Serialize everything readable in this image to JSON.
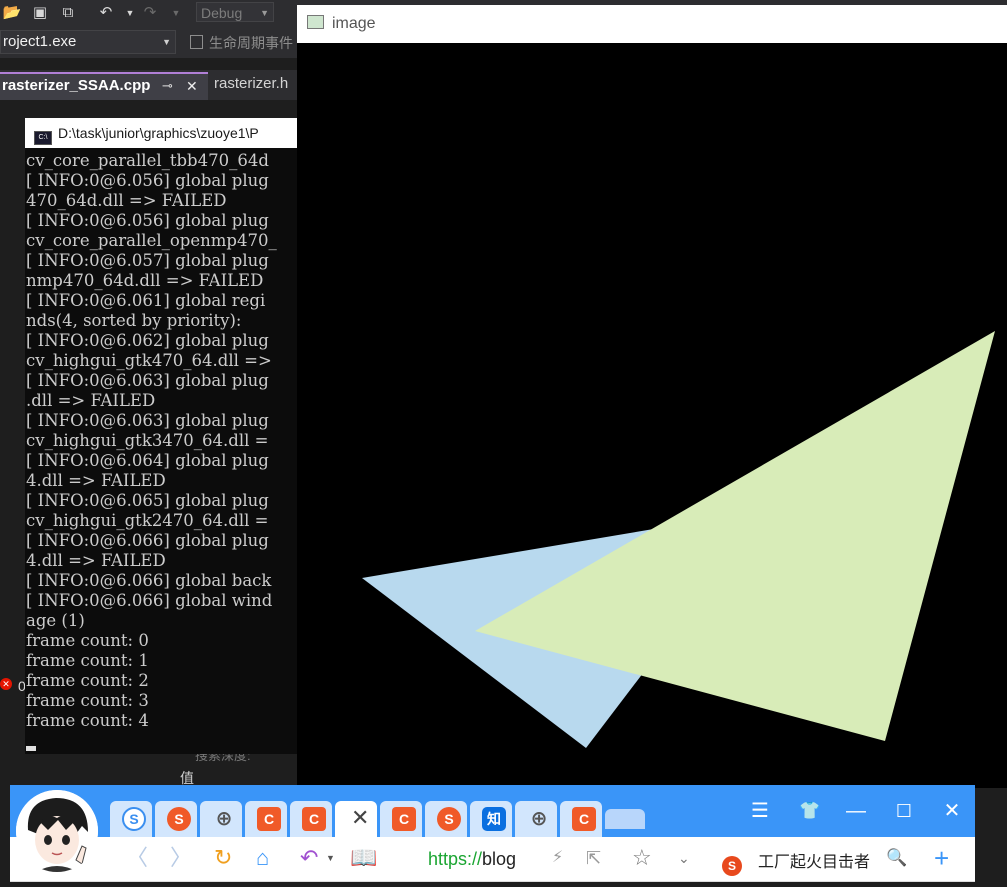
{
  "ide": {
    "config": "Debug",
    "project": "roject1.exe",
    "lifecycle": "生命周期事件",
    "active_tab": "rasterizer_SSAA.cpp",
    "tab2": "rasterizer.h",
    "error_count": "0",
    "search_hint": "搜索深度:",
    "value_hint": "值"
  },
  "console": {
    "title": "D:\\task\\junior\\graphics\\zuoye1\\P",
    "lines": [
      "cv_core_parallel_tbb470_64d",
      "[ INFO:0@6.056] global plug",
      "470_64d.dll => FAILED",
      "[ INFO:0@6.056] global plug",
      "cv_core_parallel_openmp470_",
      "[ INFO:0@6.057] global plug",
      "nmp470_64d.dll => FAILED",
      "[ INFO:0@6.061] global regi",
      "nds(4, sorted by priority):",
      "[ INFO:0@6.062] global plug",
      "cv_highgui_gtk470_64.dll =>",
      "[ INFO:0@6.063] global plug",
      ".dll => FAILED",
      "[ INFO:0@6.063] global plug",
      "cv_highgui_gtk3470_64.dll =",
      "[ INFO:0@6.064] global plug",
      "4.dll => FAILED",
      "[ INFO:0@6.065] global plug",
      "cv_highgui_gtk2470_64.dll =",
      "[ INFO:0@6.066] global plug",
      "4.dll => FAILED",
      "[ INFO:0@6.066] global back",
      "[ INFO:0@6.066] global wind",
      "age (1)",
      "frame count: 0",
      "frame count: 1",
      "frame count: 2",
      "frame count: 3",
      "frame count: 4"
    ]
  },
  "image_window": {
    "title": "image",
    "colors": {
      "blue_triangle": "#b8d9ee",
      "green_triangle": "#d8ecb8",
      "background": "#000000"
    }
  },
  "browser": {
    "url_scheme": "https://",
    "url_rest": "blog",
    "search_text": "工厂起火目击者",
    "tabs": [
      {
        "icon": "sogou-s-icon",
        "label": "S",
        "color": "#3a8ff0",
        "ring": true
      },
      {
        "icon": "sogou-icon",
        "label": "S",
        "color": "#f05a28"
      },
      {
        "icon": "globe-icon",
        "label": "⊕",
        "color": "#555555"
      },
      {
        "icon": "csdn-icon",
        "label": "C",
        "color": "#f05a28"
      },
      {
        "icon": "csdn-icon",
        "label": "C",
        "color": "#f05a28"
      },
      {
        "icon": "close-icon",
        "label": "✕",
        "color": "#444444",
        "active": true
      },
      {
        "icon": "csdn-icon",
        "label": "C",
        "color": "#f05a28"
      },
      {
        "icon": "sogou-icon",
        "label": "S",
        "color": "#f05a28"
      },
      {
        "icon": "zhihu-icon",
        "label": "知",
        "color": "#0a6fe0"
      },
      {
        "icon": "globe-icon",
        "label": "⊕",
        "color": "#555555"
      },
      {
        "icon": "csdn-icon",
        "label": "C",
        "color": "#f05a28"
      }
    ]
  }
}
